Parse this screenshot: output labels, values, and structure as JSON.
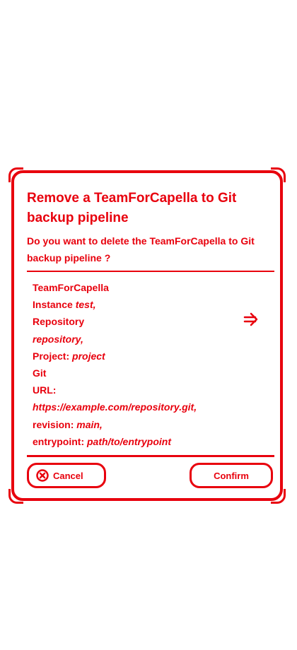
{
  "dialog": {
    "title": "Remove a TeamForCapella to Git backup pipeline",
    "question": "Do you want to delete the TeamForCapella to Git backup pipeline ?",
    "details": {
      "t4c_label": "TeamForCapella",
      "instance_label": "Instance",
      "instance_value": "test,",
      "repository_label": "Repository",
      "repository_value": "repository,",
      "project_label": "Project:",
      "project_value": "project",
      "git_label": "Git",
      "url_label": "URL:",
      "url_value": "https://example.com/repository.git,",
      "revision_label": "revision:",
      "revision_value": "main,",
      "entrypoint_label": "entrypoint:",
      "entrypoint_value": "path/to/entrypoint"
    },
    "icons": {
      "arrow": "arrow-right-icon",
      "cancel": "cancel-icon"
    },
    "buttons": {
      "cancel_label": "Cancel",
      "confirm_label": "Confirm"
    },
    "colors": {
      "accent": "#e8000d",
      "background": "#ffffff"
    }
  }
}
